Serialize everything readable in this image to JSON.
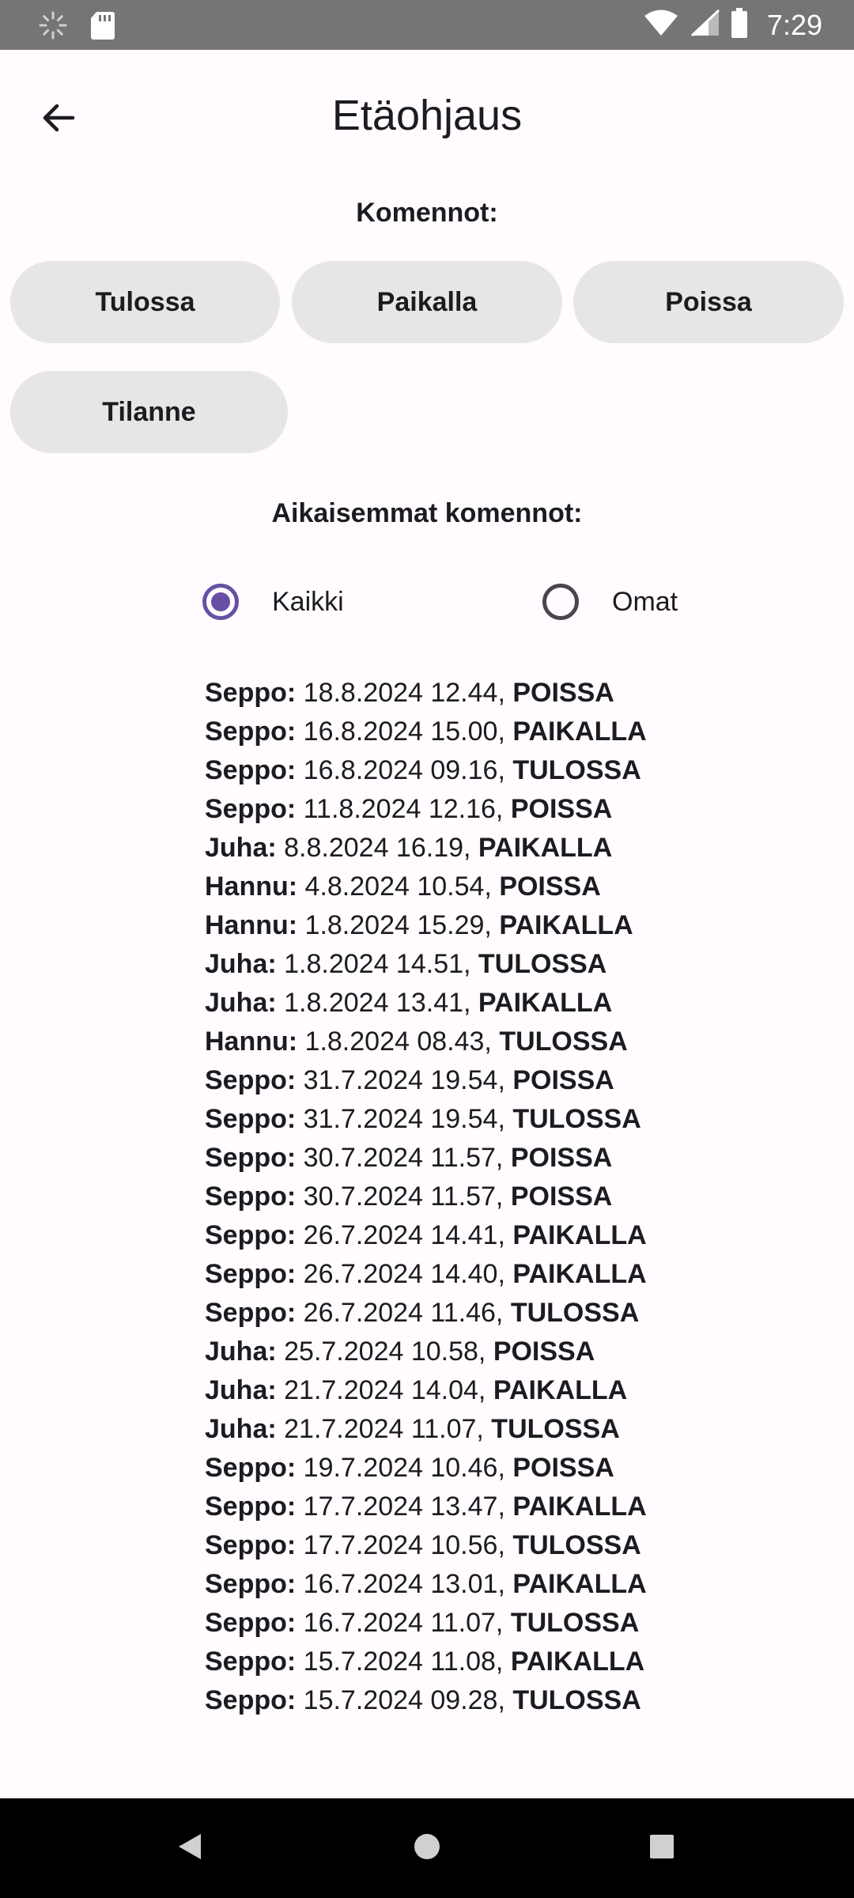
{
  "status_bar": {
    "time": "7:29",
    "icons": [
      "loading-icon",
      "sd-card-icon",
      "wifi-icon",
      "signal-icon",
      "battery-icon"
    ]
  },
  "app_bar": {
    "title": "Etäohjaus",
    "back_icon": "arrow-back-icon"
  },
  "commands": {
    "heading": "Komennot:",
    "buttons": [
      "Tulossa",
      "Paikalla",
      "Poissa",
      "Tilanne"
    ]
  },
  "history": {
    "heading": "Aikaisemmat komennot:",
    "filter": {
      "options": [
        "Kaikki",
        "Omat"
      ],
      "selected": "Kaikki"
    },
    "items": [
      {
        "name": "Seppo:",
        "datetime": " 18.8.2024 12.44, ",
        "status": "POISSA"
      },
      {
        "name": "Seppo:",
        "datetime": " 16.8.2024 15.00, ",
        "status": "PAIKALLA"
      },
      {
        "name": "Seppo:",
        "datetime": " 16.8.2024 09.16, ",
        "status": "TULOSSA"
      },
      {
        "name": "Seppo:",
        "datetime": " 11.8.2024 12.16, ",
        "status": "POISSA"
      },
      {
        "name": "Juha:",
        "datetime": " 8.8.2024 16.19, ",
        "status": "PAIKALLA"
      },
      {
        "name": "Hannu:",
        "datetime": " 4.8.2024 10.54, ",
        "status": "POISSA"
      },
      {
        "name": "Hannu:",
        "datetime": " 1.8.2024 15.29, ",
        "status": "PAIKALLA"
      },
      {
        "name": "Juha:",
        "datetime": " 1.8.2024 14.51, ",
        "status": "TULOSSA"
      },
      {
        "name": "Juha:",
        "datetime": " 1.8.2024 13.41, ",
        "status": "PAIKALLA"
      },
      {
        "name": "Hannu:",
        "datetime": " 1.8.2024 08.43, ",
        "status": "TULOSSA"
      },
      {
        "name": "Seppo:",
        "datetime": " 31.7.2024 19.54, ",
        "status": "POISSA"
      },
      {
        "name": "Seppo:",
        "datetime": " 31.7.2024 19.54, ",
        "status": "TULOSSA"
      },
      {
        "name": "Seppo:",
        "datetime": " 30.7.2024 11.57, ",
        "status": "POISSA"
      },
      {
        "name": "Seppo:",
        "datetime": " 30.7.2024 11.57, ",
        "status": "POISSA"
      },
      {
        "name": "Seppo:",
        "datetime": " 26.7.2024 14.41, ",
        "status": "PAIKALLA"
      },
      {
        "name": "Seppo:",
        "datetime": " 26.7.2024 14.40, ",
        "status": "PAIKALLA"
      },
      {
        "name": "Seppo:",
        "datetime": " 26.7.2024 11.46, ",
        "status": "TULOSSA"
      },
      {
        "name": "Juha:",
        "datetime": " 25.7.2024 10.58, ",
        "status": "POISSA"
      },
      {
        "name": "Juha:",
        "datetime": " 21.7.2024 14.04, ",
        "status": "PAIKALLA"
      },
      {
        "name": "Juha:",
        "datetime": " 21.7.2024 11.07, ",
        "status": "TULOSSA"
      },
      {
        "name": "Seppo:",
        "datetime": " 19.7.2024 10.46, ",
        "status": "POISSA"
      },
      {
        "name": "Seppo:",
        "datetime": " 17.7.2024 13.47, ",
        "status": "PAIKALLA"
      },
      {
        "name": "Seppo:",
        "datetime": " 17.7.2024 10.56, ",
        "status": "TULOSSA"
      },
      {
        "name": "Seppo:",
        "datetime": " 16.7.2024 13.01, ",
        "status": "PAIKALLA"
      },
      {
        "name": "Seppo:",
        "datetime": " 16.7.2024 11.07, ",
        "status": "TULOSSA"
      },
      {
        "name": "Seppo:",
        "datetime": " 15.7.2024 11.08, ",
        "status": "PAIKALLA"
      },
      {
        "name": "Seppo:",
        "datetime": " 15.7.2024 09.28, ",
        "status": "TULOSSA"
      }
    ]
  },
  "nav_bar": {
    "icons": [
      "back-triangle-icon",
      "home-circle-icon",
      "recents-square-icon"
    ]
  },
  "colors": {
    "accent": "#6750a4",
    "button_bg": "#e6e6e6",
    "background": "#fffbfe",
    "status_bar": "#757575"
  }
}
